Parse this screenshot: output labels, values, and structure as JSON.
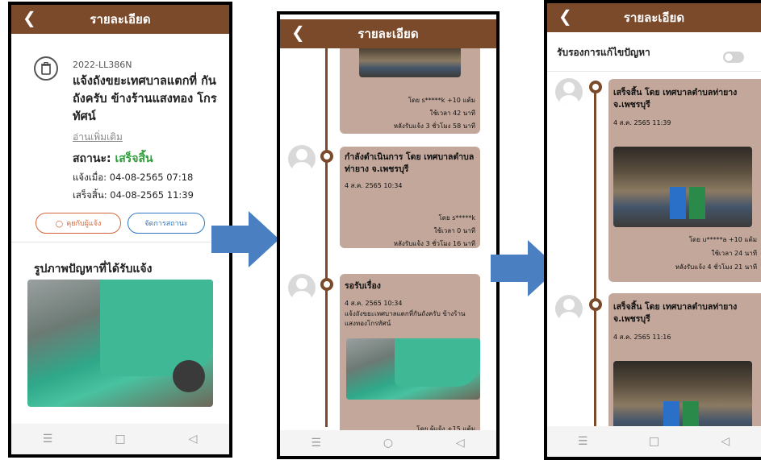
{
  "header_title": "รายละเอียด",
  "nav_icons": [
    "menu-icon",
    "home-icon",
    "back-icon"
  ],
  "phone1": {
    "report_code": "2022-LL386N",
    "report_title": "แจ้งถังขยะเทศบาลแตกที่ กันถังครับ ข้างร้านแสงทอง โกรทัศน์",
    "read_more": "อ่านเพิ่มเติม",
    "status_label": "สถานะ:",
    "status_value": "เสร็จสิ้น",
    "reported_at": "แจ้งเมื่อ: 04-08-2565 07:18",
    "finished_at": "เสร็จสิ้น: 04-08-2565 11:39",
    "chat_button": "คุยกับผู้แจ้ง",
    "manage_button": "จัดการสถานะ",
    "photo_section": "รูปภาพปัญหาที่ได้รับแจ้ง"
  },
  "phone2": {
    "top_card": {
      "rating": "โดย s*****k +10 แต้ม",
      "time_used": "ใช้เวลา 42 นาที",
      "after": "หลังรับแจ้ง 3 ชั่วโมง 58 นาที"
    },
    "card2": {
      "title": "กำลังดำเนินการ โดย เทศบาลตำบลท่ายาง จ.เพชรบุรี",
      "date": "4 ส.ค. 2565 10:34",
      "rating": "โดย s*****k",
      "time_used": "ใช้เวลา 0 นาที",
      "after": "หลังรับแจ้ง 3 ชั่วโมง 16 นาที"
    },
    "card3": {
      "title": "รอรับเรื่อง",
      "date": "4 ส.ค. 2565 10:34",
      "desc": "แจ้งถังขยะเทศบาลแตกที่กันถังครับ ข้างร้าน แสงทองโกรทัศน์",
      "rating": "โดย ผู้แจ้ง +15 แต้ม"
    }
  },
  "phone3": {
    "toggle_label": "รับรองการแก้ไขปัญหา",
    "toggle_on": false,
    "card1": {
      "title": "เสร็จสิ้น โดย เทศบาลตำบลท่ายาง จ.เพชรบุรี",
      "date": "4 ส.ค. 2565 11:39",
      "rating": "โดย u*****a +10 แต้ม",
      "time_used": "ใช้เวลา 24 นาที",
      "after": "หลังรับแจ้ง 4 ชั่วโมง 21 นาที"
    },
    "card2": {
      "title": "เสร็จสิ้น โดย เทศบาลตำบลท่ายาง จ.เพชรบุรี",
      "date": "4 ส.ค. 2565 11:16"
    }
  },
  "colors": {
    "header": "#7a4a2b",
    "card": "#c3a79a",
    "status_done": "#2e9e3a",
    "arrow": "#4a7fc1"
  }
}
